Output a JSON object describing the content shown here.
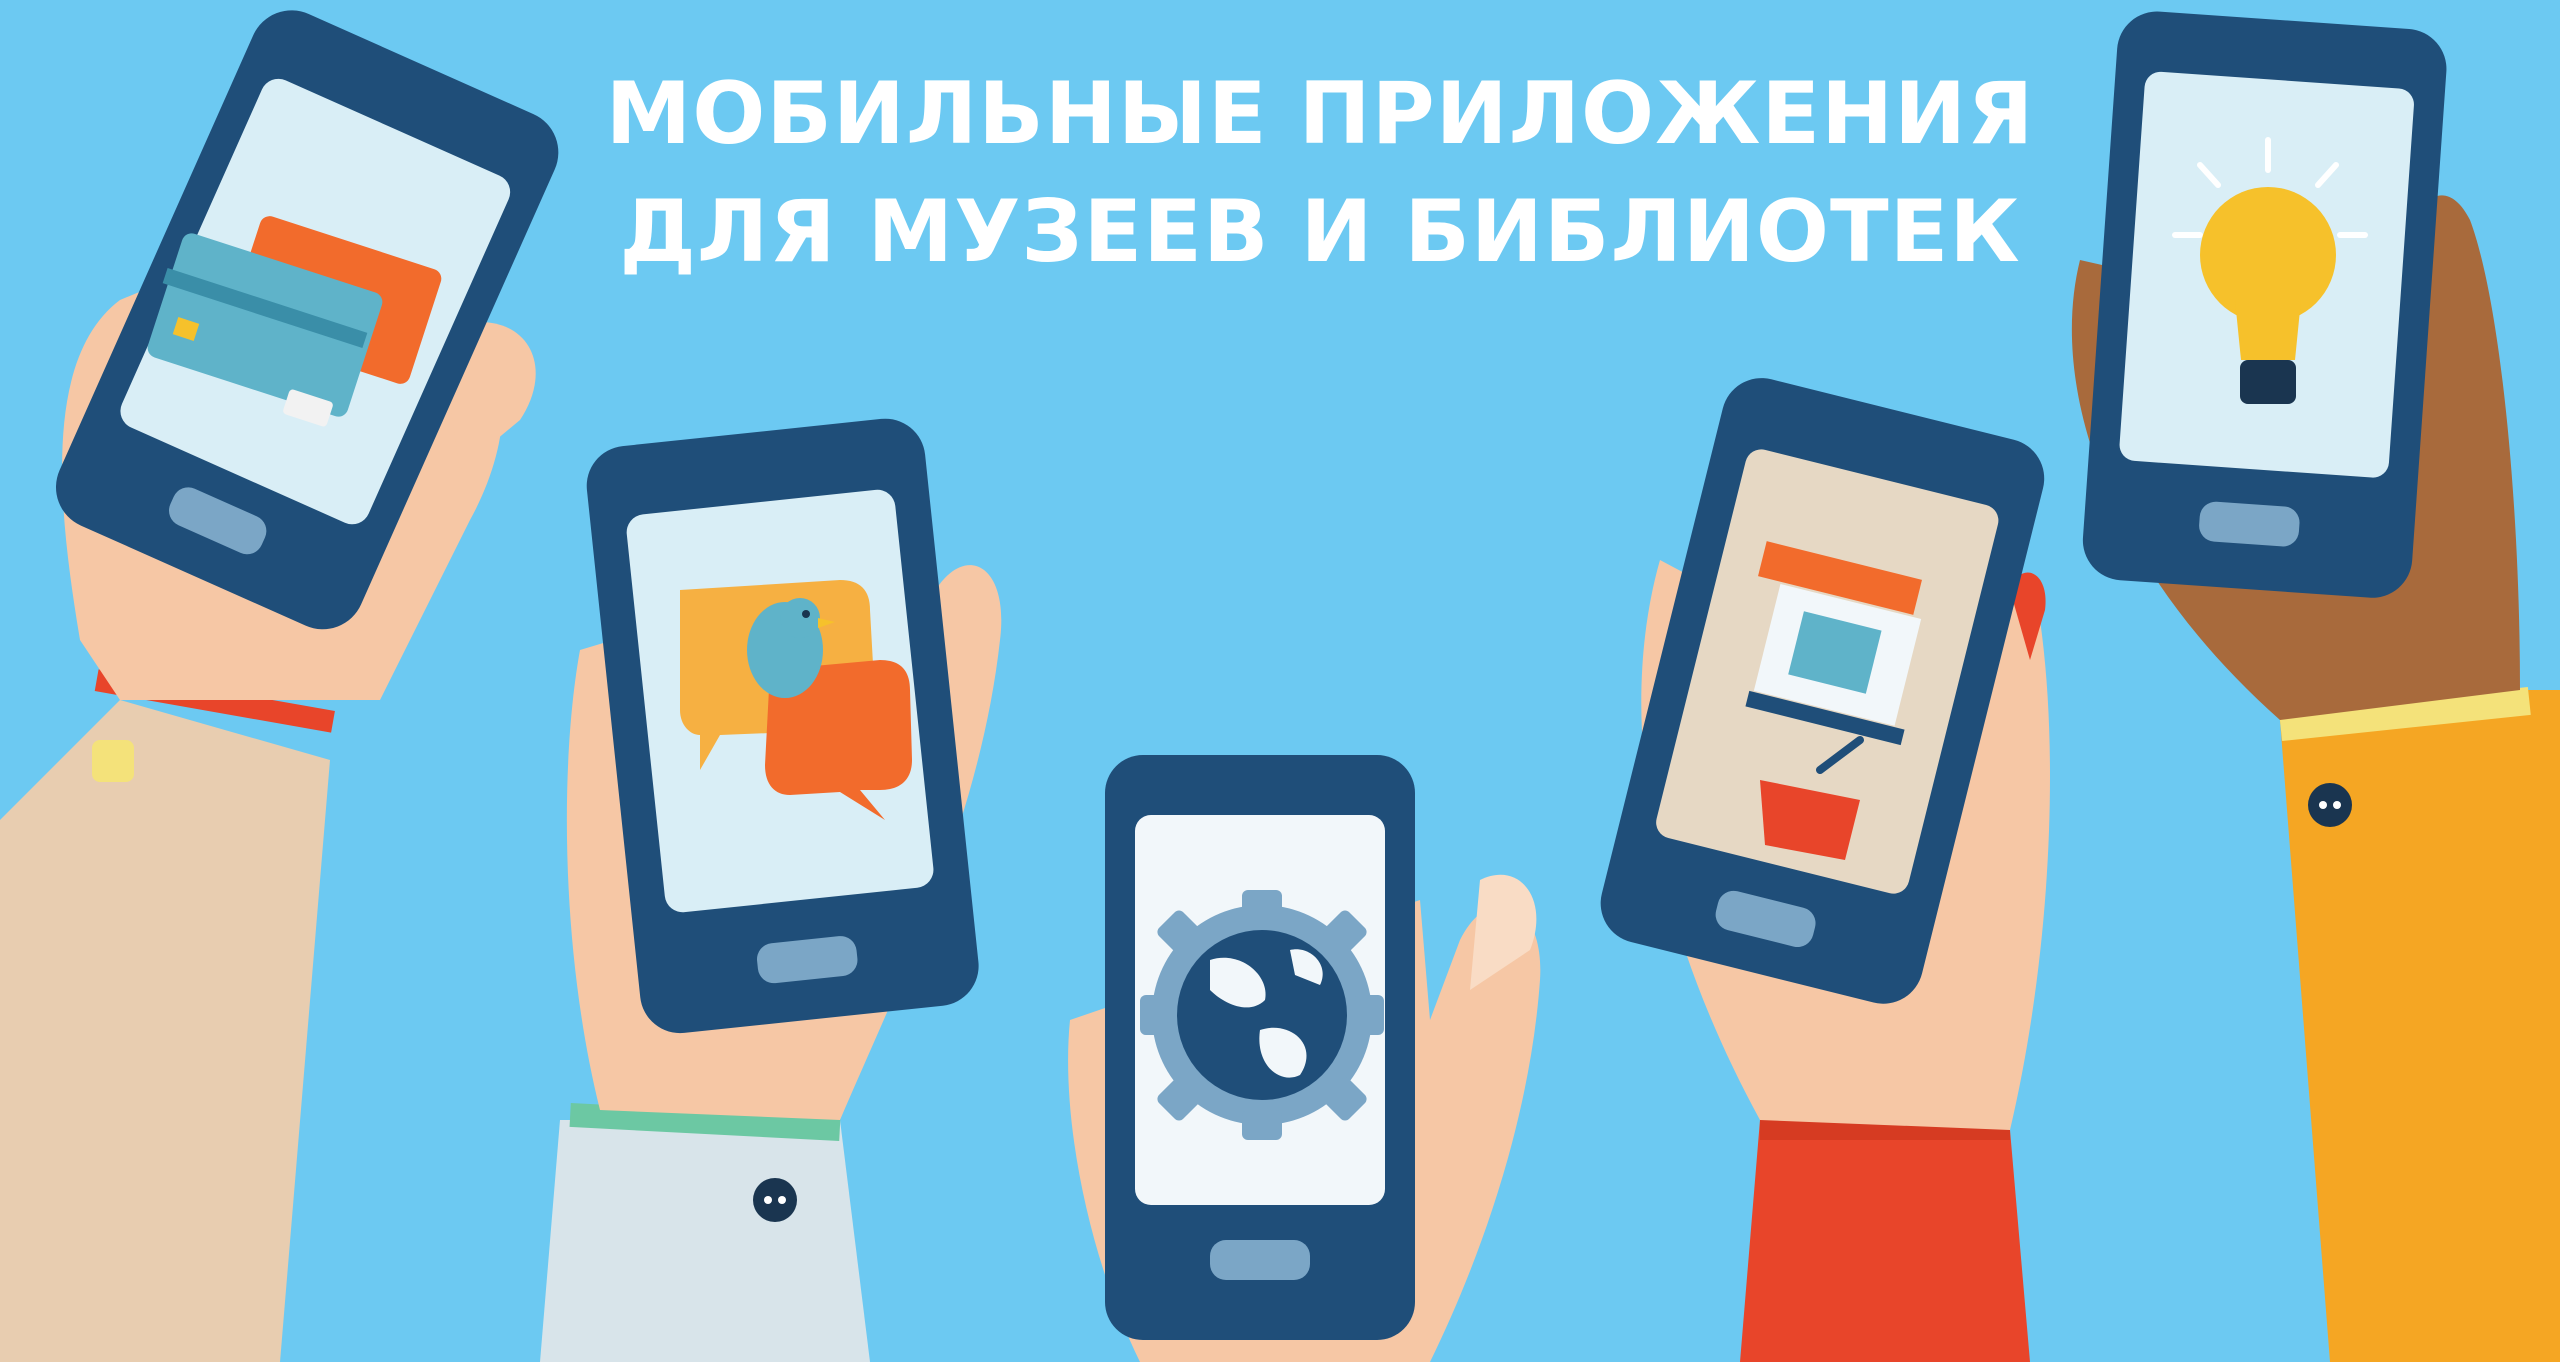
{
  "headline": {
    "line1": "МОБИЛЬНЫЕ ПРИЛОЖЕНИЯ",
    "line2": "ДЛЯ МУЗЕЕВ И БИБЛИОТЕК"
  },
  "colors": {
    "background": "#6cc9f2",
    "phone_body": "#1f4e79",
    "phone_screen_light": "#d9eef6",
    "accent_orange": "#f26b2c",
    "accent_yellow": "#f6c12b"
  },
  "icons": [
    "credit-card-icon",
    "chat-bird-icon",
    "globe-gear-icon",
    "shop-basket-icon",
    "lightbulb-icon"
  ]
}
